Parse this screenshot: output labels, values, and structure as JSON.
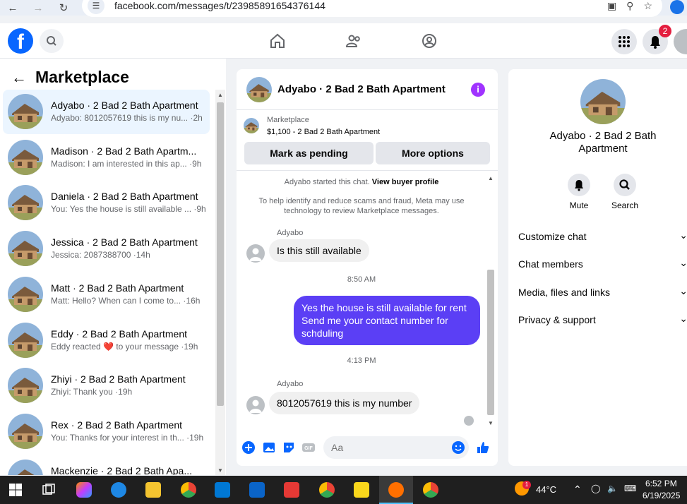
{
  "browser": {
    "url": "facebook.com/messages/t/23985891654376144"
  },
  "header": {
    "notifications_count": "2"
  },
  "left": {
    "back_label": "←",
    "title": "Marketplace",
    "conversations": [
      {
        "name": "Adyabo · 2 Bad 2 Bath Apartment",
        "preview": "Adyabo: 8012057619 this is my nu... ·2h",
        "active": true
      },
      {
        "name": "Madison · 2 Bad 2 Bath Apartm...",
        "preview": "Madison: I am interested in this ap... ·9h",
        "active": false
      },
      {
        "name": "Daniela · 2 Bad 2 Bath Apartment",
        "preview": "You: Yes the house is still available ... ·9h",
        "active": false
      },
      {
        "name": "Jessica · 2 Bad 2 Bath Apartment",
        "preview": "Jessica: 2087388700 ·14h",
        "active": false
      },
      {
        "name": "Matt · 2 Bad 2 Bath Apartment",
        "preview": "Matt: Hello? When can I come to... ·16h",
        "active": false
      },
      {
        "name": "Eddy · 2 Bad 2 Bath Apartment",
        "preview": "Eddy reacted ❤️ to your message ·19h",
        "active": false
      },
      {
        "name": "Zhiyi · 2 Bad 2 Bath Apartment",
        "preview": "Zhiyi: Thank you ·19h",
        "active": false
      },
      {
        "name": "Rex · 2 Bad 2 Bath Apartment",
        "preview": "You: Thanks for your interest in th... ·19h",
        "active": false
      },
      {
        "name": "Mackenzie · 2 Bad 2 Bath Apa...",
        "preview": "",
        "active": false
      }
    ]
  },
  "chat": {
    "title": "Adyabo · 2 Bad 2 Bath Apartment",
    "marketplace_label": "Marketplace",
    "listing": "$1,100 - 2 Bad 2 Bath Apartment",
    "mark_pending_label": "Mark as pending",
    "more_options_label": "More options",
    "started_text": "Adyabo started this chat.",
    "view_profile_label": "View buyer profile",
    "safety_notice": "To help identify and reduce scams and fraud, Meta may use technology to review Marketplace messages.",
    "messages": [
      {
        "sender": "Adyabo",
        "text": "Is this still available",
        "direction": "in"
      },
      {
        "time": "8:50 AM"
      },
      {
        "text": "Yes the house is still available for rent Send me your contact number for schduling",
        "direction": "out"
      },
      {
        "time": "4:13 PM"
      },
      {
        "sender": "Adyabo",
        "text": "8012057619 this is my number",
        "direction": "in"
      }
    ],
    "input_placeholder": "Aa"
  },
  "details": {
    "name": "Adyabo · 2 Bad 2 Bath Apartment",
    "mute_label": "Mute",
    "search_label": "Search",
    "sections": [
      "Customize chat",
      "Chat members",
      "Media, files and links",
      "Privacy & support"
    ]
  },
  "taskbar": {
    "temperature": "44°C",
    "time": "6:52 PM",
    "date": "6/19/2025",
    "weather_badge": "1"
  },
  "colors": {
    "fb_blue": "#0866ff",
    "outgoing_bubble": "#5b3ff5",
    "info_icon": "#a033ff"
  }
}
